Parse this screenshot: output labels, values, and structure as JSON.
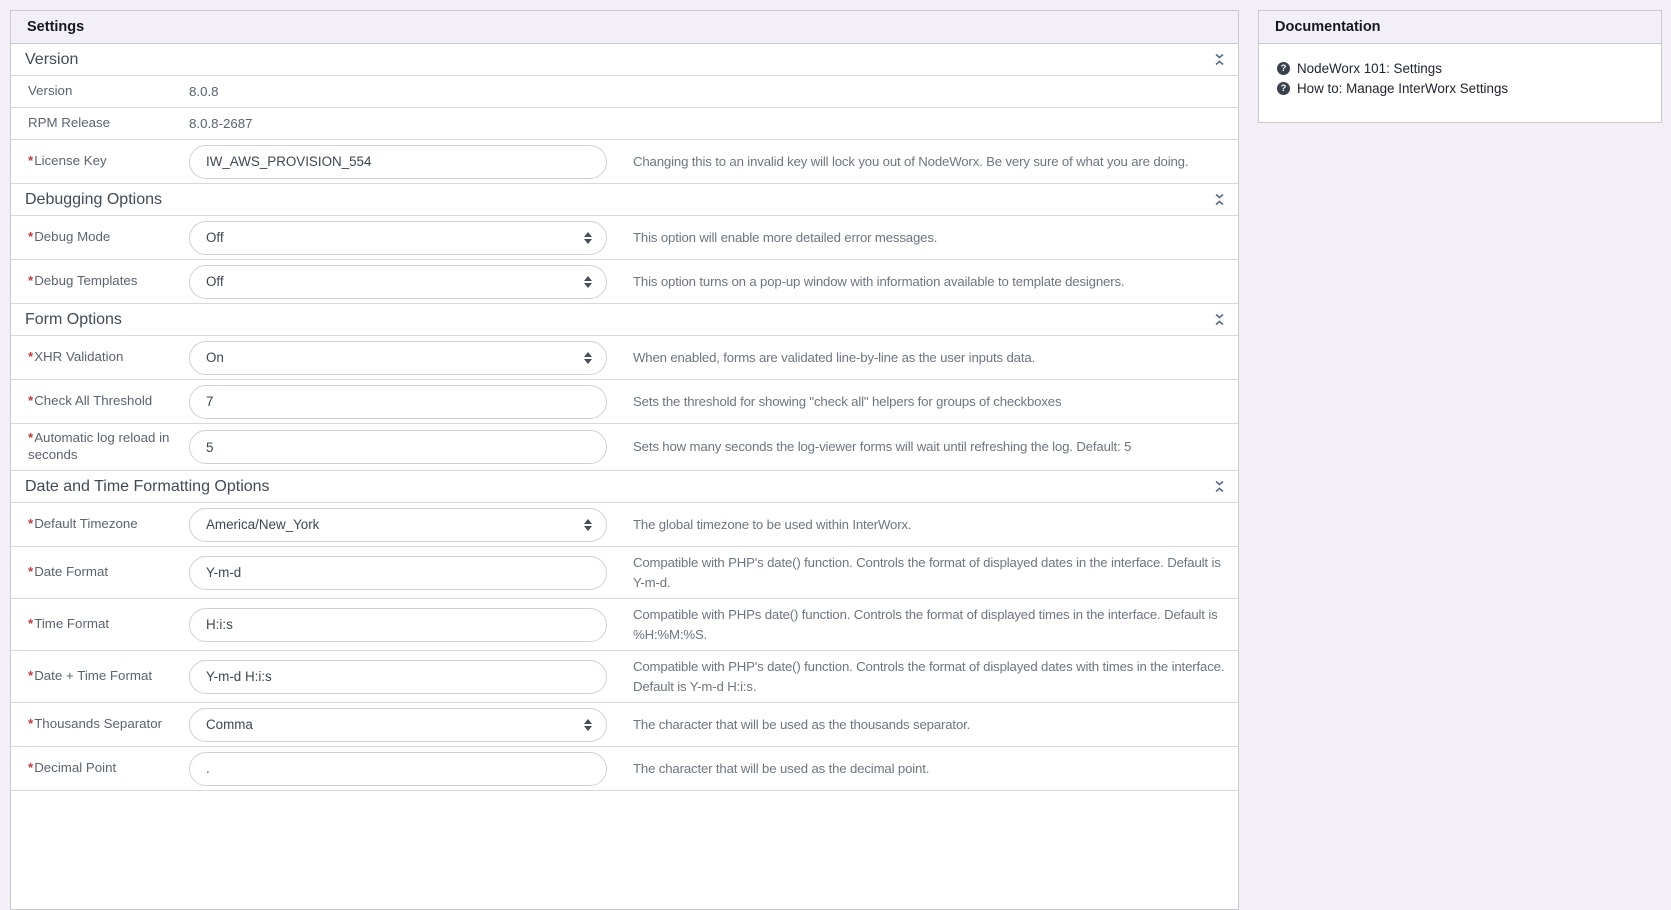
{
  "icons": {
    "collapse": "double-chevron-collapse",
    "select": "up-down-arrows",
    "doc_link": "question-circle"
  },
  "colors": {
    "page_bg": "#f4eff7",
    "panel_border": "#c9c9cf",
    "header_bg": "#f3eff6",
    "required_asterisk": "#bf3a3c"
  },
  "settings_panel": {
    "title": "Settings",
    "sections": [
      {
        "title": "Version",
        "rows": [
          {
            "label": "Version",
            "value": "8.0.8"
          },
          {
            "label": "RPM Release",
            "value": "8.0.8-2687"
          },
          {
            "label": "License Key",
            "value": "IW_AWS_PROVISION_554",
            "help": "Changing this to an invalid key will lock you out of NodeWorx. Be very sure of what you are doing."
          }
        ]
      },
      {
        "title": "Debugging Options",
        "rows": [
          {
            "label": "Debug Mode",
            "value": "Off",
            "help": "This option will enable more detailed error messages."
          },
          {
            "label": "Debug Templates",
            "value": "Off",
            "help": "This option turns on a pop-up window with information available to template designers."
          }
        ]
      },
      {
        "title": "Form Options",
        "rows": [
          {
            "label": "XHR Validation",
            "value": "On",
            "help": "When enabled, forms are validated line-by-line as the user inputs data."
          },
          {
            "label": "Check All Threshold",
            "value": "7",
            "help": "Sets the threshold for showing \"check all\" helpers for groups of checkboxes"
          },
          {
            "label": "Automatic log reload in seconds",
            "value": "5",
            "help": "Sets how many seconds the log-viewer forms will wait until refreshing the log. Default: 5"
          }
        ]
      },
      {
        "title": "Date and Time Formatting Options",
        "rows": [
          {
            "label": "Default Timezone",
            "value": "America/New_York",
            "help": "The global timezone to be used within InterWorx."
          },
          {
            "label": "Date Format",
            "value": "Y-m-d",
            "help": "Compatible with PHP's date() function. Controls the format of displayed dates in the interface. Default is Y-m-d."
          },
          {
            "label": "Time Format",
            "value": "H:i:s",
            "help": "Compatible with PHPs date() function. Controls the format of displayed times in the interface. Default is %H:%M:%S."
          },
          {
            "label": "Date + Time Format",
            "value": "Y-m-d H:i:s",
            "help": "Compatible with PHP's date() function. Controls the format of displayed dates with times in the interface. Default is Y-m-d H:i:s."
          },
          {
            "label": "Thousands Separator",
            "value": "Comma",
            "help": "The character that will be used as the thousands separator."
          },
          {
            "label": "Decimal Point",
            "value": ".",
            "help": "The character that will be used as the decimal point."
          }
        ]
      }
    ]
  },
  "documentation_panel": {
    "title": "Documentation",
    "links": [
      {
        "label": "NodeWorx 101: Settings"
      },
      {
        "label": "How to: Manage InterWorx Settings"
      }
    ]
  }
}
